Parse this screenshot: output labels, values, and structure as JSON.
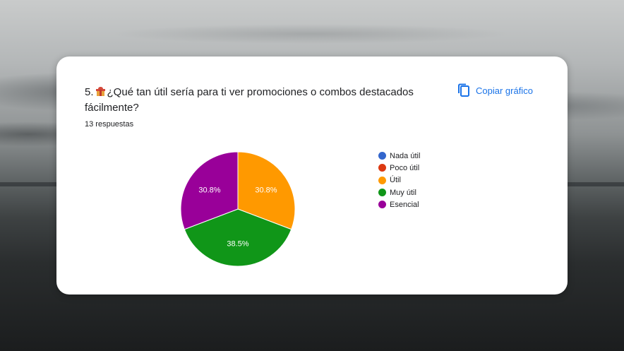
{
  "question": {
    "number": "5.",
    "text": "¿Qué tan útil sería para ti ver promociones o combos destacados fácilmente?",
    "icon": "gift-icon"
  },
  "responses_label": "13 respuestas",
  "copy_button": {
    "label": "Copiar gráfico",
    "icon": "copy-icon"
  },
  "colors": {
    "accent": "#1a73e8"
  },
  "chart_data": {
    "type": "pie",
    "total": 13,
    "slices": [
      {
        "label": "Nada útil",
        "value": 0,
        "percent": 0.0,
        "percent_label": "",
        "color": "#3366cc"
      },
      {
        "label": "Poco útil",
        "value": 0,
        "percent": 0.0,
        "percent_label": "",
        "color": "#dc3912"
      },
      {
        "label": "Útil",
        "value": 4,
        "percent": 30.8,
        "percent_label": "30.8%",
        "color": "#ff9900"
      },
      {
        "label": "Muy útil",
        "value": 5,
        "percent": 38.5,
        "percent_label": "38.5%",
        "color": "#109618"
      },
      {
        "label": "Esencial",
        "value": 4,
        "percent": 30.8,
        "percent_label": "30.8%",
        "color": "#990099"
      }
    ],
    "legend_position": "right"
  }
}
